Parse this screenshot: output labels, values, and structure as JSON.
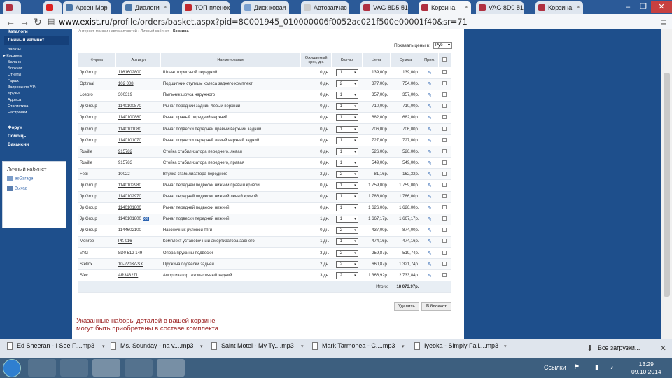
{
  "tabs": [
    {
      "label": "",
      "icon": "spider-icon"
    },
    {
      "label": "",
      "icon": "youtube-icon"
    },
    {
      "label": "Арсен Мар",
      "icon": "vk-icon"
    },
    {
      "label": "Диалоги",
      "icon": "vk-icon"
    },
    {
      "label": "ТОП пленок",
      "icon": "drive2-icon"
    },
    {
      "label": "Диск кован",
      "icon": "page-icon"
    },
    {
      "label": "Автозапчас",
      "icon": "page-icon"
    },
    {
      "label": "VAG 8D5 51",
      "icon": "spider-icon"
    },
    {
      "label": "Корзина",
      "icon": "spider-icon"
    },
    {
      "label": "VAG 8D0 51",
      "icon": "spider-icon"
    },
    {
      "label": "Корзина",
      "icon": "spider-icon"
    }
  ],
  "address": {
    "host": "www.exist.ru",
    "path": "/profile/orders/basket.aspx?pid=8C001945_010000006f0052ac021f500e00001f40&sr=71"
  },
  "sidebar": {
    "catalogs": "Каталоги",
    "cabinet": "Личный кабинет",
    "items": [
      "Заказы",
      "Корзина",
      "Баланс",
      "Блокнот",
      "Отчеты",
      "Гараж",
      "Запросы по VIN",
      "Друзья",
      "Адреса",
      "Статистика",
      "Настройки"
    ],
    "forum": "Форум",
    "help": "Помощь",
    "vacancies": "Вакансии",
    "box_title": "Личный кабинет",
    "garage": "asGarage",
    "logout": "Выход"
  },
  "breadcrumb": {
    "a": "Интернет-магазин автозапчастей",
    "b": "Личный кабинет",
    "c": "Корзина"
  },
  "show_prices_label": "Показать цены в:",
  "currency": "Руб",
  "table": {
    "headers": [
      "Фирма",
      "Артикул",
      "Наименование",
      "Ожидаемый срок, дн.",
      "Кол-во",
      "Цена",
      "Сумма",
      "Прим."
    ],
    "rows": [
      [
        "Jp Group",
        "1161602800",
        "Шланг тормозной передний",
        "0 дн.",
        "1",
        "139,00р.",
        "139,00р."
      ],
      [
        "Optimal",
        "102 008",
        "Подшипник ступицы колеса заднего комплект",
        "0 дн.",
        "2",
        "377,00р.",
        "754,00р."
      ],
      [
        "Loebro",
        "300319",
        "Пыльник шруса наружного",
        "0 дн.",
        "1",
        "357,00р.",
        "357,00р."
      ],
      [
        "Jp Group",
        "1140100870",
        "Рычаг передний задний левый верхний",
        "0 дн.",
        "1",
        "710,00р.",
        "710,00р."
      ],
      [
        "Jp Group",
        "1140100880",
        "Рычаг правый передний верхний",
        "0 дн.",
        "1",
        "682,00р.",
        "682,00р."
      ],
      [
        "Jp Group",
        "1140101080",
        "Рычаг подвески передней правый верхний задний",
        "0 дн.",
        "1",
        "706,00р.",
        "706,00р."
      ],
      [
        "Jp Group",
        "1140101070",
        "Рычаг подвески передней левый верхний задний",
        "0 дн.",
        "1",
        "727,00р.",
        "727,00р."
      ],
      [
        "Ruville",
        "915782",
        "Стойка стабилизатора переднего, левая",
        "0 дн.",
        "1",
        "526,00р.",
        "526,00р."
      ],
      [
        "Ruville",
        "915783",
        "Стойка стабилизатора переднего, правая",
        "0 дн.",
        "1",
        "549,00р.",
        "549,00р."
      ],
      [
        "Febi",
        "10022",
        "Втулка стабилизатора переднего",
        "2 дн.",
        "2",
        "81,16р.",
        "162,32р."
      ],
      [
        "Jp Group",
        "1140102980",
        "Рычаг передней подвески нижний правый кривой",
        "0 дн.",
        "1",
        "1 759,00р.",
        "1 759,00р."
      ],
      [
        "Jp Group",
        "1140102970",
        "Рычаг передней подвески нижний левый кривой",
        "0 дн.",
        "1",
        "1 786,00р.",
        "1 786,00р."
      ],
      [
        "Jp Group",
        "1140101800",
        "Рычаг передней подвески нижний",
        "0 дн.",
        "1",
        "1 626,00р.",
        "1 626,00р."
      ],
      [
        "Jp Group",
        "1140101800",
        "Рычаг подвески передней нижний",
        "1 дн.",
        "1",
        "1 667,17р.",
        "1 667,17р."
      ],
      [
        "Jp Group",
        "1144602100",
        "Наконечник рулевой тяги",
        "0 дн.",
        "2",
        "437,00р.",
        "874,00р."
      ],
      [
        "Monroe",
        "PK 016",
        "Комплект установочный амортизатора заднего",
        "1 дн.",
        "1",
        "474,16р.",
        "474,16р."
      ],
      [
        "VAG",
        "8D0 512 149",
        "Опора пружины подвески",
        "3 дн.",
        "2",
        "259,87р.",
        "519,74р."
      ],
      [
        "Stellox",
        "10-22037-SX",
        "Пружина подвески задней",
        "2 дн.",
        "2",
        "660,87р.",
        "1 321,74р."
      ],
      [
        "Sfec",
        "AR343271",
        "Амортизатор газомасляный задний",
        "3 дн.",
        "2",
        "1 366,92р.",
        "2 733,84р."
      ]
    ],
    "selected_row_tag": "XX",
    "total_label": "Итого:",
    "total_value": "18 073,97р."
  },
  "buttons": {
    "delete": "Удалить",
    "notebook": "В блокнот"
  },
  "note": "Указанные наборы деталей в вашей корзине могут быть приобретены в составе комплекта.",
  "downloads": [
    "Ed Sheeran - I See F....mp3",
    "Ms. Sounday - na v....mp3",
    "Saint Motel - My Ty....mp3",
    "Mark Tarmonea - C....mp3",
    "Iyeoka - Simply Fall....mp3"
  ],
  "all_downloads": "Все загрузки...",
  "taskbar": {
    "links": "Ссылки",
    "time": "13:29",
    "date": "09.10.2014"
  }
}
